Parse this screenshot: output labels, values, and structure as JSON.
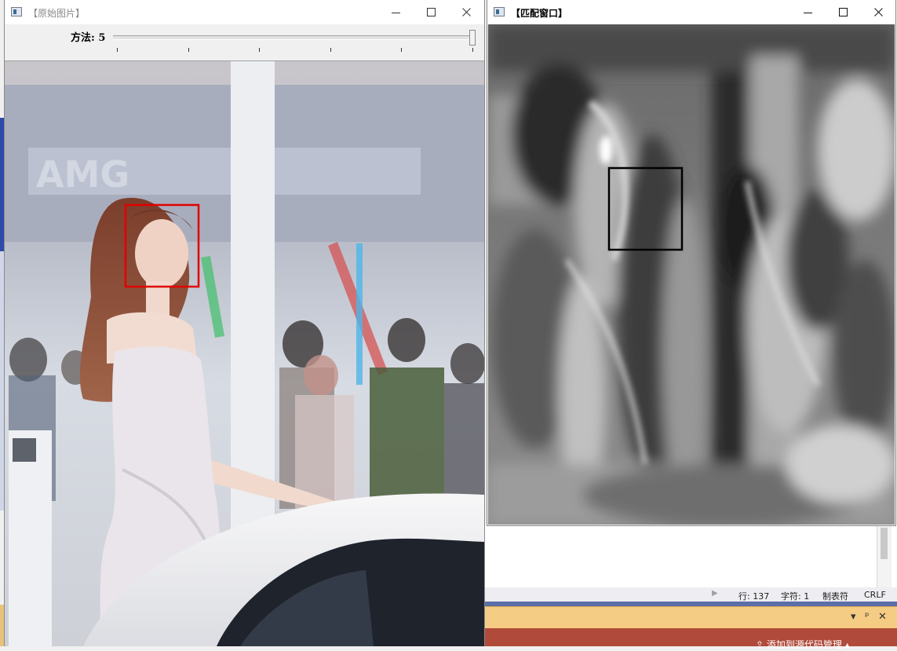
{
  "window_original": {
    "title": "【原始图片】",
    "trackbar": {
      "label": "方法: 5",
      "value": 5,
      "min": 0,
      "max": 5,
      "tick_count": 6
    },
    "image_description": "photo",
    "match_box_color": "#e00000"
  },
  "window_match": {
    "title": "【匹配窗口】",
    "image_description": "grayscale template-matching result map",
    "match_box_color": "#000000"
  },
  "ide": {
    "status": {
      "line": "行: 137",
      "char": "字符: 1",
      "indent": "制表符",
      "eol": "CRLF"
    },
    "panel_controls": [
      "▾",
      "ᵖ",
      "✕"
    ],
    "bottom_bar_text": "⇪ 添加到源代码管理 ▴"
  },
  "colors": {
    "ide_panel": "#f5cc84",
    "ide_bar": "#b04a3a",
    "ide_separator": "#5b6ea8"
  }
}
